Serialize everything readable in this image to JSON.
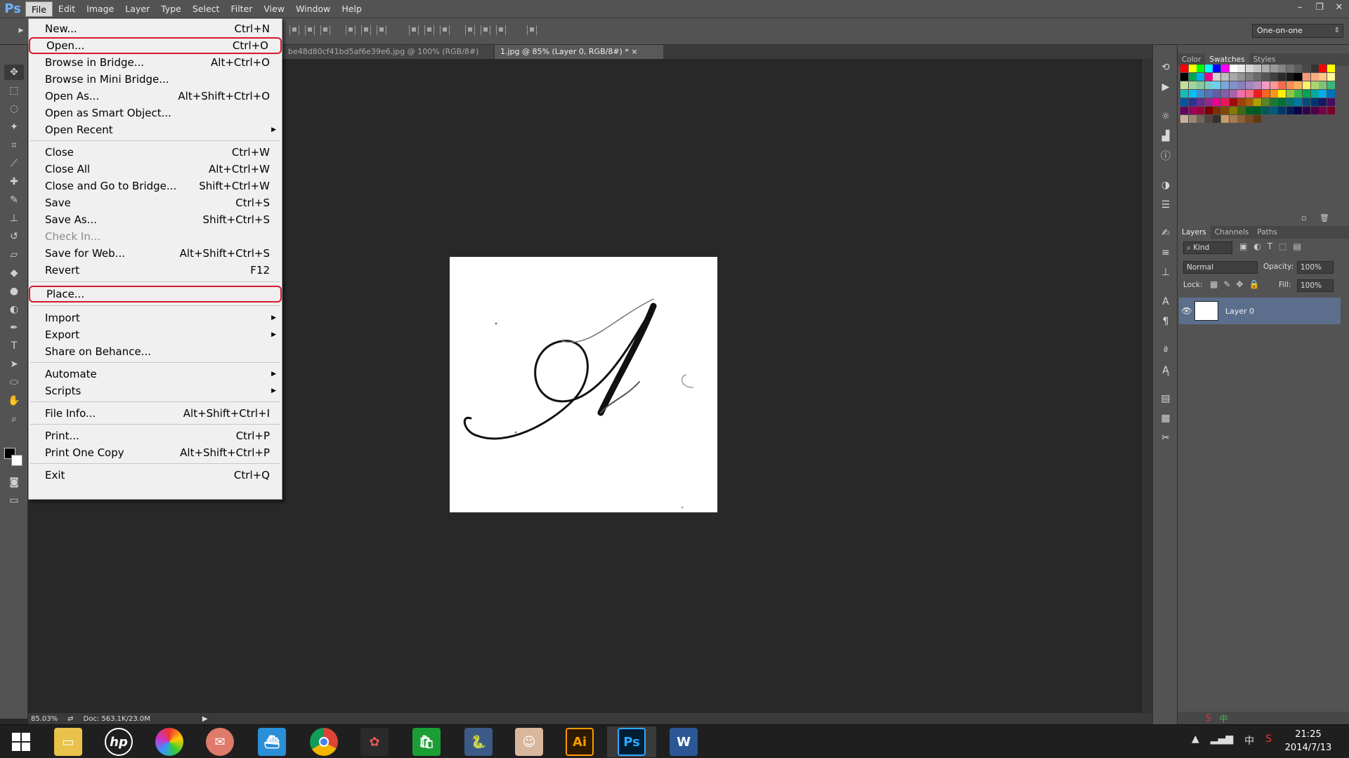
{
  "app": {
    "logo": "Ps"
  },
  "menubar": [
    "File",
    "Edit",
    "Image",
    "Layer",
    "Type",
    "Select",
    "Filter",
    "View",
    "Window",
    "Help"
  ],
  "window_controls": [
    "–",
    "❐",
    "✕"
  ],
  "options": {
    "workspace": "One-on-one"
  },
  "tabs": [
    {
      "label": "be48d80cf41bd5af6e39e6.jpg @ 100% (RGB/8#)",
      "close": "×"
    },
    {
      "label": "1.jpg @ 85% (Layer 0, RGB/8#) *",
      "close": "×"
    }
  ],
  "file_menu": [
    {
      "label": "New...",
      "shortcut": "Ctrl+N"
    },
    {
      "label": "Open...",
      "shortcut": "Ctrl+O",
      "highlight": true
    },
    {
      "label": "Browse in Bridge...",
      "shortcut": "Alt+Ctrl+O"
    },
    {
      "label": "Browse in Mini Bridge...",
      "shortcut": ""
    },
    {
      "label": "Open As...",
      "shortcut": "Alt+Shift+Ctrl+O"
    },
    {
      "label": "Open as Smart Object...",
      "shortcut": ""
    },
    {
      "label": "Open Recent",
      "shortcut": "",
      "submenu": true
    },
    {
      "label": "Close",
      "shortcut": "Ctrl+W"
    },
    {
      "label": "Close All",
      "shortcut": "Alt+Ctrl+W"
    },
    {
      "label": "Close and Go to Bridge...",
      "shortcut": "Shift+Ctrl+W"
    },
    {
      "label": "Save",
      "shortcut": "Ctrl+S"
    },
    {
      "label": "Save As...",
      "shortcut": "Shift+Ctrl+S"
    },
    {
      "label": "Check In...",
      "shortcut": "",
      "disabled": true
    },
    {
      "label": "Save for Web...",
      "shortcut": "Alt+Shift+Ctrl+S"
    },
    {
      "label": "Revert",
      "shortcut": "F12"
    },
    {
      "label": "Place...",
      "shortcut": "",
      "highlight": true
    },
    {
      "label": "Import",
      "shortcut": "",
      "submenu": true
    },
    {
      "label": "Export",
      "shortcut": "",
      "submenu": true
    },
    {
      "label": "Share on Behance...",
      "shortcut": ""
    },
    {
      "label": "Automate",
      "shortcut": "",
      "submenu": true
    },
    {
      "label": "Scripts",
      "shortcut": "",
      "submenu": true
    },
    {
      "label": "File Info...",
      "shortcut": "Alt+Shift+Ctrl+I"
    },
    {
      "label": "Print...",
      "shortcut": "Ctrl+P"
    },
    {
      "label": "Print One Copy",
      "shortcut": "Alt+Shift+Ctrl+P"
    },
    {
      "label": "Exit",
      "shortcut": "Ctrl+Q"
    }
  ],
  "status": {
    "zoom": "85.03%",
    "doc": "Doc: 563.1K/23.0M"
  },
  "color_panel": {
    "tabs": [
      "Color",
      "Swatches",
      "Styles"
    ],
    "active": "Swatches"
  },
  "layers_panel": {
    "tabs": [
      "Layers",
      "Channels",
      "Paths"
    ],
    "filter": "Kind",
    "blend_mode": "Normal",
    "opacity_label": "Opacity:",
    "opacity": "100%",
    "lock_label": "Lock:",
    "fill_label": "Fill:",
    "fill": "100%",
    "layers": [
      {
        "name": "Layer 0",
        "visible": true,
        "selected": true
      }
    ]
  },
  "taskbar": {
    "apps": [
      "windows-start",
      "file-explorer",
      "hp",
      "media-player",
      "mail-app",
      "docker-app",
      "chrome",
      "pinwheel-app",
      "store",
      "python-ide",
      "photo-viewer",
      "illustrator",
      "photoshop",
      "word"
    ],
    "labels": {
      "illustrator": "Ai",
      "photoshop": "Ps",
      "word": "W",
      "hp": "hp"
    },
    "clock_time": "21:25",
    "clock_date": "2014/7/13",
    "ime": "中"
  },
  "accent": {
    "highlight_red": "#d6182b",
    "layer_selected": "#5b6f8c",
    "ps_blue": "#31a8ff"
  }
}
